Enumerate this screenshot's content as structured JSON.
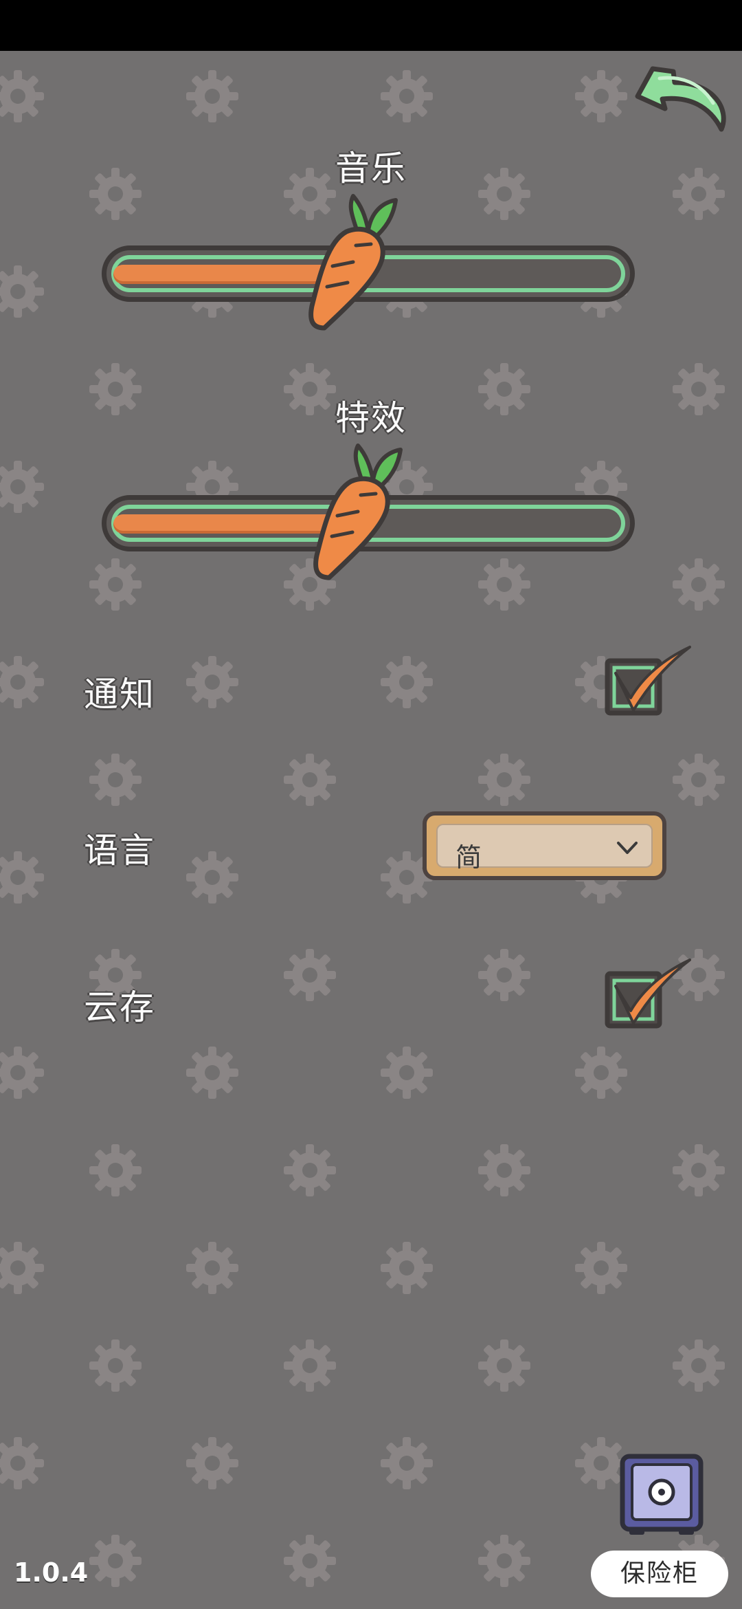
{
  "settings": {
    "music_label": "音乐",
    "music_volume_fraction": 0.45,
    "effects_label": "特效",
    "effects_volume_fraction": 0.46,
    "notification_label": "通知",
    "notification_checked": true,
    "language_label": "语言",
    "language_value": "简",
    "cloud_save_label": "云存",
    "cloud_save_checked": true
  },
  "footer": {
    "version": "1.0.4",
    "safe_label": "保险柜"
  },
  "icons": {
    "back": "back-arrow-icon",
    "slider_thumb": "carrot-icon",
    "checkbox": "checkmark-icon",
    "dropdown": "chevron-down-icon",
    "safe": "safe-icon",
    "pattern": "gear-icon"
  },
  "colors": {
    "background": "#727070",
    "track_outline": "#7fd49a",
    "fill": "#e9874a",
    "check": "#ef8a47"
  }
}
